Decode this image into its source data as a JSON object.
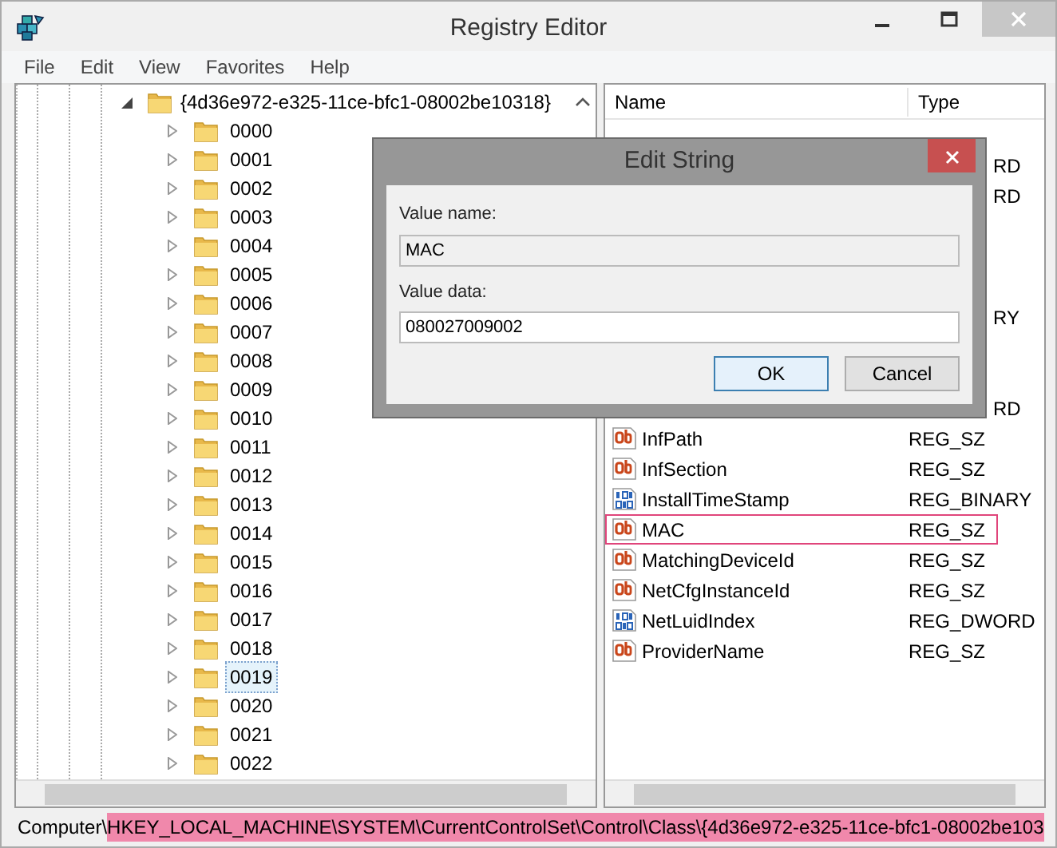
{
  "window": {
    "title": "Registry Editor"
  },
  "menu": [
    "File",
    "Edit",
    "View",
    "Favorites",
    "Help"
  ],
  "tree": {
    "label": "{4d36e972-e325-11ce-bfc1-08002be10318}",
    "expanded": true,
    "children": [
      {
        "label": "0000",
        "selected": false
      },
      {
        "label": "0001",
        "selected": false
      },
      {
        "label": "0002",
        "selected": false
      },
      {
        "label": "0003",
        "selected": false
      },
      {
        "label": "0004",
        "selected": false
      },
      {
        "label": "0005",
        "selected": false
      },
      {
        "label": "0006",
        "selected": false
      },
      {
        "label": "0007",
        "selected": false
      },
      {
        "label": "0008",
        "selected": false
      },
      {
        "label": "0009",
        "selected": false
      },
      {
        "label": "0010",
        "selected": false
      },
      {
        "label": "0011",
        "selected": false
      },
      {
        "label": "0012",
        "selected": false
      },
      {
        "label": "0013",
        "selected": false
      },
      {
        "label": "0014",
        "selected": false
      },
      {
        "label": "0015",
        "selected": false
      },
      {
        "label": "0016",
        "selected": false
      },
      {
        "label": "0017",
        "selected": false
      },
      {
        "label": "0018",
        "selected": false
      },
      {
        "label": "0019",
        "selected": true
      },
      {
        "label": "0020",
        "selected": false
      },
      {
        "label": "0021",
        "selected": false
      },
      {
        "label": "0022",
        "selected": false
      }
    ]
  },
  "values": {
    "columns": [
      "Name",
      "Type"
    ],
    "rows": [
      {
        "kind": "covered"
      },
      {
        "kind": "covered",
        "type": "RD"
      },
      {
        "kind": "covered",
        "type": "RD"
      },
      {
        "kind": "covered"
      },
      {
        "kind": "covered"
      },
      {
        "kind": "covered"
      },
      {
        "kind": "covered",
        "type": "RY"
      },
      {
        "kind": "covered"
      },
      {
        "kind": "covered"
      },
      {
        "kind": "covered",
        "type": "RD"
      },
      {
        "kind": "string",
        "name": "InfPath",
        "type": "REG_SZ",
        "highlighted": false
      },
      {
        "kind": "string",
        "name": "InfSection",
        "type": "REG_SZ",
        "highlighted": false
      },
      {
        "kind": "binary",
        "name": "InstallTimeStamp",
        "type": "REG_BINARY",
        "highlighted": false
      },
      {
        "kind": "string",
        "name": "MAC",
        "type": "REG_SZ",
        "highlighted": true
      },
      {
        "kind": "string",
        "name": "MatchingDeviceId",
        "type": "REG_SZ",
        "highlighted": false
      },
      {
        "kind": "string",
        "name": "NetCfgInstanceId",
        "type": "REG_SZ",
        "highlighted": false
      },
      {
        "kind": "binary",
        "name": "NetLuidIndex",
        "type": "REG_DWORD",
        "highlighted": false
      },
      {
        "kind": "string",
        "name": "ProviderName",
        "type": "REG_SZ",
        "highlighted": false
      }
    ]
  },
  "dialog": {
    "title": "Edit String",
    "value_name_label": "Value name:",
    "value_name": "MAC",
    "value_data_label": "Value data:",
    "value_data": "080027009002",
    "buttons": [
      "OK",
      "Cancel"
    ]
  },
  "status_bar": {
    "root": "Computer",
    "separator": "\\",
    "path": "HKEY_LOCAL_MACHINE\\SYSTEM\\CurrentControlSet\\Control\\Class\\{4d36e972-e325-11ce-bfc1-08002be103"
  }
}
